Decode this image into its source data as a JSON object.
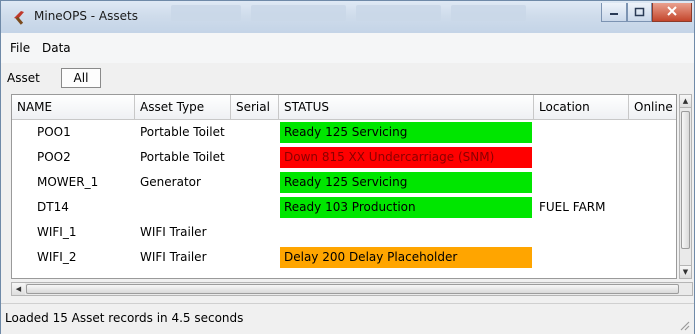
{
  "window": {
    "title": "MineOPS - Assets"
  },
  "menu": {
    "items": [
      "File",
      "Data"
    ]
  },
  "toolbar": {
    "label": "Asset",
    "filter_value": "All"
  },
  "grid": {
    "columns": [
      "NAME",
      "Asset Type",
      "Serial",
      "STATUS",
      "Location",
      "Online"
    ],
    "rows": [
      {
        "name": "POO1",
        "asset_type": "Portable Toilet",
        "serial": "",
        "status": "Ready 125 Servicing",
        "status_color": "#00e600",
        "status_text_color": "#000000",
        "location": "",
        "online": ""
      },
      {
        "name": "POO2",
        "asset_type": "Portable Toilet",
        "serial": "",
        "status": "Down 815 XX Undercarriage (SNM)",
        "status_color": "#ff0000",
        "status_text_color": "#8b0000",
        "location": "",
        "online": ""
      },
      {
        "name": "MOWER_1",
        "asset_type": "Generator",
        "serial": "",
        "status": "Ready 125 Servicing",
        "status_color": "#00e600",
        "status_text_color": "#000000",
        "location": "",
        "online": ""
      },
      {
        "name": "DT14",
        "asset_type": "",
        "serial": "",
        "status": "Ready 103 Production",
        "status_color": "#00e600",
        "status_text_color": "#000000",
        "location": "FUEL FARM",
        "online": ""
      },
      {
        "name": "WIFI_1",
        "asset_type": "WIFI Trailer",
        "serial": "",
        "status": "",
        "status_color": "",
        "status_text_color": "#000000",
        "location": "",
        "online": ""
      },
      {
        "name": "WIFI_2",
        "asset_type": "WIFI Trailer",
        "serial": "",
        "status": "Delay 200 Delay Placeholder",
        "status_color": "#ffa500",
        "status_text_color": "#000000",
        "location": "",
        "online": ""
      }
    ]
  },
  "status_bar": {
    "text": "Loaded 15 Asset records in 4.5 seconds"
  },
  "icons": {
    "app": "pickaxe-icon",
    "minimize": "minimize-icon",
    "maximize": "maximize-icon",
    "close": "close-icon"
  }
}
